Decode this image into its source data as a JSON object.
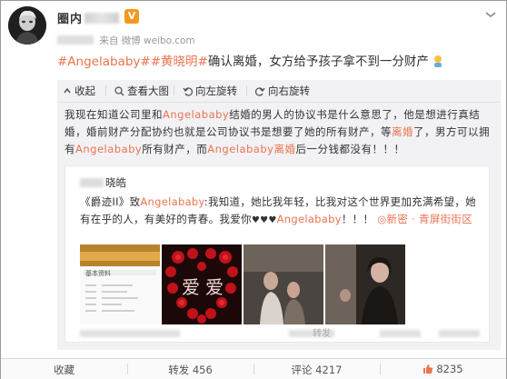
{
  "header": {
    "username": "圈内",
    "verified_badge": "V",
    "source_prefix": "来自",
    "source": "微博 weibo.com"
  },
  "post": {
    "tag1": "#Angelababy#",
    "tag2": "#黄晓明#",
    "text": "确认离婚，女方给予孩子拿不到一分财产"
  },
  "toolbar": {
    "collapse": "收起",
    "view_large": "查看大图",
    "rotate_left": "向左旋转",
    "rotate_right": "向右旋转"
  },
  "quote": {
    "p1": "我现在知道公司里和",
    "hl1": "Angelababy",
    "p2": "结婚的男人的协议书是什么意思了，他是想进行真结婚，婚前财产分配协约也就是公司协议书是想要了她的所有财产，等",
    "hl2": "离婚",
    "p3": "了，男方可以拥有",
    "hl3": "Angelababy",
    "p4": "所有财产，而",
    "hl4": "Angelababy离婚",
    "p5": "后一分钱都没有！！！"
  },
  "inner": {
    "username_suffix": "晓皓",
    "p1": "《爵迹II》致",
    "hl1": "Angelababy",
    "p2": ":我知道，她比我年轻，比我对这个世界更加充满希望，她有在乎的人，有美好的青春。我爱你",
    "hearts": "♥♥♥",
    "hl2": "Angelababy",
    "p3": "！！！",
    "location": "◎新密 · 青屏街街区",
    "thumb1_caption": "基本资料"
  },
  "watermark": "转发",
  "actions": {
    "favorite": "收藏",
    "repost": "转发 456",
    "comment": "评论 4217",
    "like": "8235"
  },
  "colors": {
    "accent": "#eb7350",
    "verified": "#f29a1d",
    "card_bg": "#f2f2f5"
  }
}
